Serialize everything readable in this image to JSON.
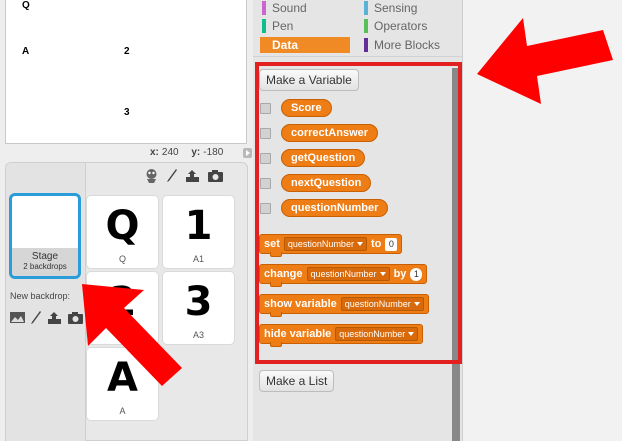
{
  "stage": {
    "texts": [
      {
        "id": "q",
        "text": "Q"
      },
      {
        "id": "a",
        "text": "A"
      },
      {
        "id": "2",
        "text": "2"
      },
      {
        "id": "3",
        "text": "3"
      }
    ],
    "coords": {
      "x_label": "x:",
      "x_value": "240",
      "y_label": "y:",
      "y_value": "-180"
    }
  },
  "stage_panel": {
    "name": "Stage",
    "subtitle": "2 backdrops",
    "new_backdrop_label": "New backdrop:"
  },
  "costumes": [
    {
      "glyph": "Q",
      "caption": "Q"
    },
    {
      "glyph": "1",
      "caption": "A1"
    },
    {
      "glyph": "2",
      "caption": ""
    },
    {
      "glyph": "3",
      "caption": "A3"
    },
    {
      "glyph": "A",
      "caption": "A"
    }
  ],
  "categories": [
    {
      "label": "Sound",
      "color": "#cf63cf",
      "active": false
    },
    {
      "label": "Sensing",
      "color": "#5cb1d6",
      "active": false
    },
    {
      "label": "Pen",
      "color": "#0fbd8c",
      "active": false
    },
    {
      "label": "Operators",
      "color": "#59c059",
      "active": false
    },
    {
      "label": "Data",
      "color": "#ee7d16",
      "active": true
    },
    {
      "label": "More Blocks",
      "color": "#632d99",
      "active": false
    }
  ],
  "palette": {
    "make_variable": "Make a Variable",
    "make_list": "Make a List",
    "variables": [
      "Score",
      "correctAnswer",
      "getQuestion",
      "nextQuestion",
      "questionNumber"
    ],
    "blocks": {
      "set": {
        "verb": "set",
        "var": "questionNumber",
        "joiner": "to",
        "value": "0"
      },
      "change": {
        "verb": "change",
        "var": "questionNumber",
        "joiner": "by",
        "value": "1"
      },
      "show": {
        "verb": "show variable",
        "var": "questionNumber"
      },
      "hide": {
        "verb": "hide variable",
        "var": "questionNumber"
      }
    }
  },
  "colors": {
    "data_orange": "#ee7d16",
    "highlight_red": "#e32020",
    "selection_blue": "#2a9cd9"
  }
}
